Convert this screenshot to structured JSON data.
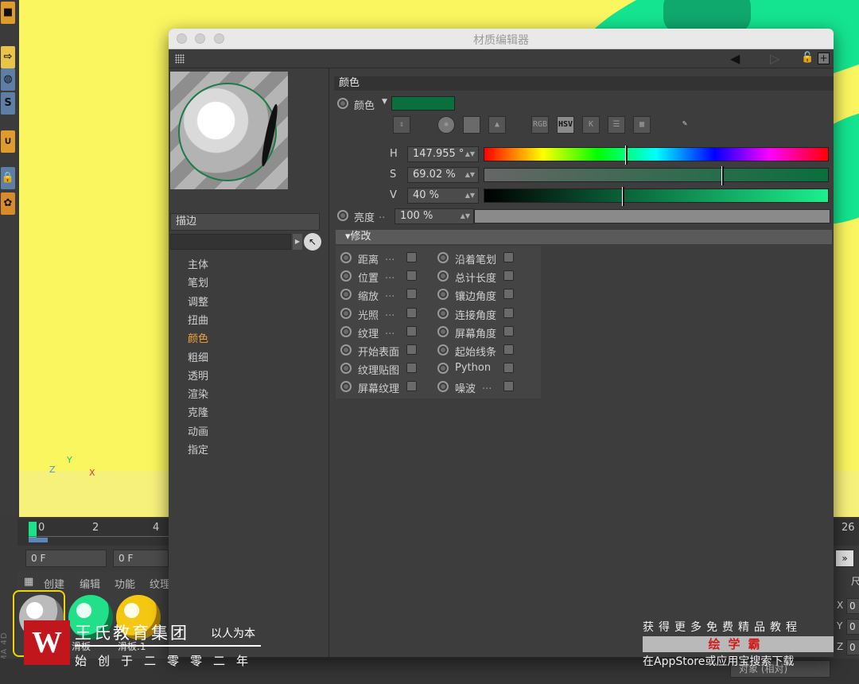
{
  "window": {
    "title": "材质编辑器"
  },
  "left_pane": {
    "stroke_label": "描边",
    "channels": [
      "主体",
      "笔划",
      "调整",
      "扭曲",
      "颜色",
      "粗细",
      "透明",
      "渲染",
      "克隆",
      "动画",
      "指定"
    ],
    "active_channel": "颜色"
  },
  "color_section": {
    "header": "颜色",
    "color_label": "颜色",
    "swatch_color": "#0a6f3d",
    "modes": [
      "RGB",
      "HSV",
      "K"
    ],
    "active_mode": "HSV",
    "h_label": "H",
    "h_value": "147.955 °",
    "h_fraction": 0.41,
    "s_label": "S",
    "s_value": "69.02 %",
    "s_fraction": 0.69,
    "v_label": "V",
    "v_value": "40 %",
    "v_fraction": 0.4,
    "brightness_label": "亮度",
    "brightness_value": "100 %"
  },
  "modify_section": {
    "header": "修改",
    "left_items": [
      "距离",
      "位置",
      "缩放",
      "光照",
      "纹理",
      "开始表面",
      "纹理贴图",
      "屏幕纹理"
    ],
    "left_dots": [
      true,
      true,
      true,
      true,
      true,
      false,
      false,
      false
    ],
    "right_items": [
      "沿着笔划",
      "总计长度",
      "镶边角度",
      "连接角度",
      "屏幕角度",
      "起始线条",
      "Python",
      "噪波"
    ],
    "right_dots": [
      false,
      false,
      false,
      false,
      false,
      false,
      false,
      true
    ]
  },
  "background": {
    "timeline_numbers": [
      "0",
      "2",
      "4",
      "26"
    ],
    "frame_start": "0 F",
    "frame_current": "0 F",
    "material_tabs": [
      "创建",
      "编辑",
      "功能",
      "纹理"
    ],
    "materials": [
      "滑板",
      "滑板.1"
    ],
    "coord_labels": [
      "X",
      "Y",
      "Z"
    ],
    "coord_values": [
      "0",
      "0",
      "0"
    ],
    "right_header": "尺",
    "object_select": "对象 (相对)",
    "brand": "CINEMA 4D",
    "axis_labels": [
      "Y",
      "Z",
      "X"
    ]
  },
  "watermark": {
    "logo": "W",
    "name": "王氏教育集团",
    "slogan": "以人为本",
    "since": "始创于二零零二年",
    "right_line1": "获得更多免费精品教程",
    "right_line2": "绘学霸",
    "right_line3": "在AppStore或应用宝搜索下载"
  }
}
